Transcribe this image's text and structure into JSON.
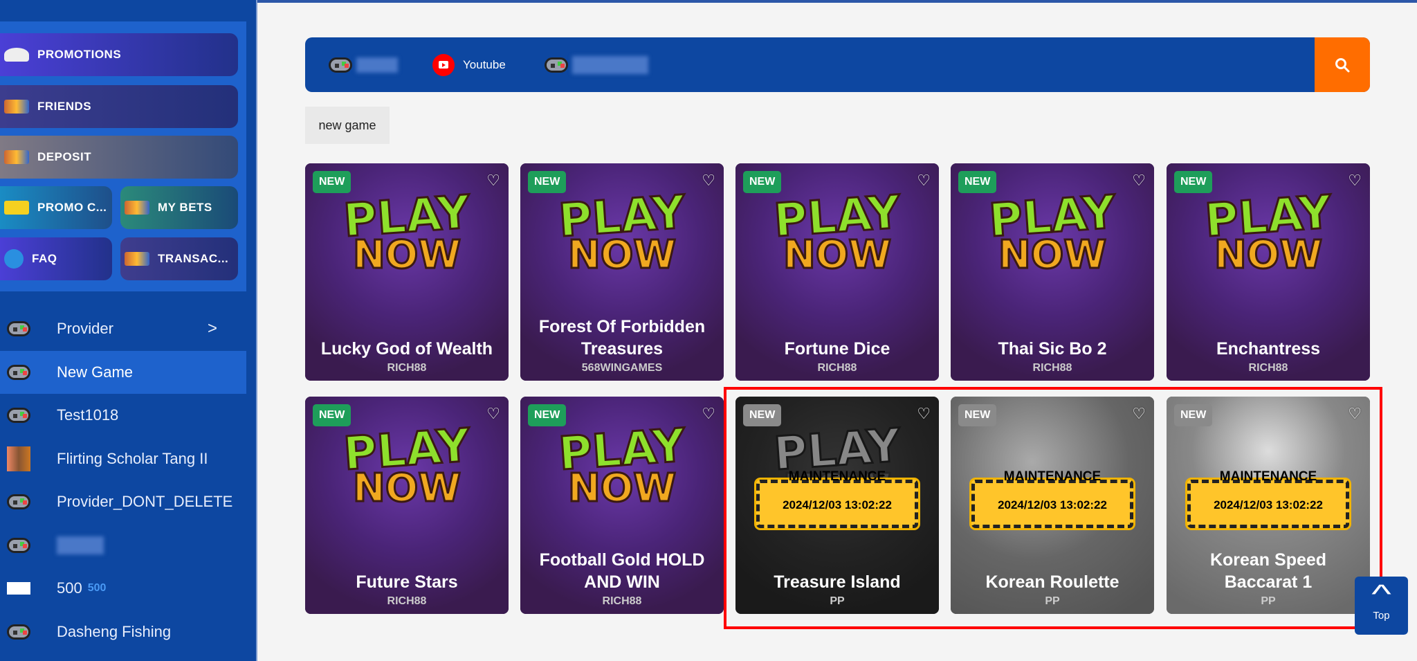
{
  "sidebar": {
    "quick": [
      {
        "label": "PROMOTIONS",
        "icon": "promotions-icon"
      },
      {
        "label": "FRIENDS",
        "icon": "friends-icon"
      },
      {
        "label": "DEPOSIT",
        "icon": "deposit-icon"
      },
      {
        "label": "PROMO C...",
        "icon": "promo-code-icon"
      },
      {
        "label": "MY BETS",
        "icon": "my-bets-icon"
      },
      {
        "label": "FAQ",
        "icon": "faq-icon"
      },
      {
        "label": "TRANSAC...",
        "icon": "transactions-icon"
      }
    ],
    "nav": [
      {
        "label": "Provider"
      },
      {
        "label": "New Game"
      },
      {
        "label": "Test1018"
      },
      {
        "label": "Flirting Scholar Tang II"
      },
      {
        "label": "Provider_DONT_DELETE"
      },
      {
        "label": ""
      },
      {
        "label": "500",
        "sup": "500"
      },
      {
        "label": "Dasheng Fishing"
      }
    ]
  },
  "search": {
    "links": [
      {
        "label": "Youtube"
      }
    ]
  },
  "filter_tag": "new game",
  "art": {
    "play": "PLAY",
    "now": "NOW"
  },
  "badge_new": "NEW",
  "maintenance": {
    "label": "MAINTENANCE",
    "time": "2024/12/03 13:02:22"
  },
  "games": [
    {
      "title": "Lucky God of Wealth",
      "provider": "RICH88"
    },
    {
      "title": "Forest Of Forbidden Treasures",
      "provider": "568WINGAMES"
    },
    {
      "title": "Fortune Dice",
      "provider": "RICH88"
    },
    {
      "title": "Thai Sic Bo 2",
      "provider": "RICH88"
    },
    {
      "title": "Enchantress",
      "provider": "RICH88"
    },
    {
      "title": "Future Stars",
      "provider": "RICH88"
    },
    {
      "title": "Football Gold HOLD AND WIN",
      "provider": "RICH88"
    },
    {
      "title": "Treasure Island",
      "provider": "PP"
    },
    {
      "title": "Korean Roulette",
      "provider": "PP"
    },
    {
      "title": "Korean Speed Baccarat 1",
      "provider": "PP"
    }
  ],
  "top_button": "Top",
  "colors": {
    "sidebar": "#0d47a1",
    "active": "#1e62cc",
    "search_button": "#ff6d00",
    "new_badge": "#1e9e5a",
    "highlight": "#ff0000"
  }
}
